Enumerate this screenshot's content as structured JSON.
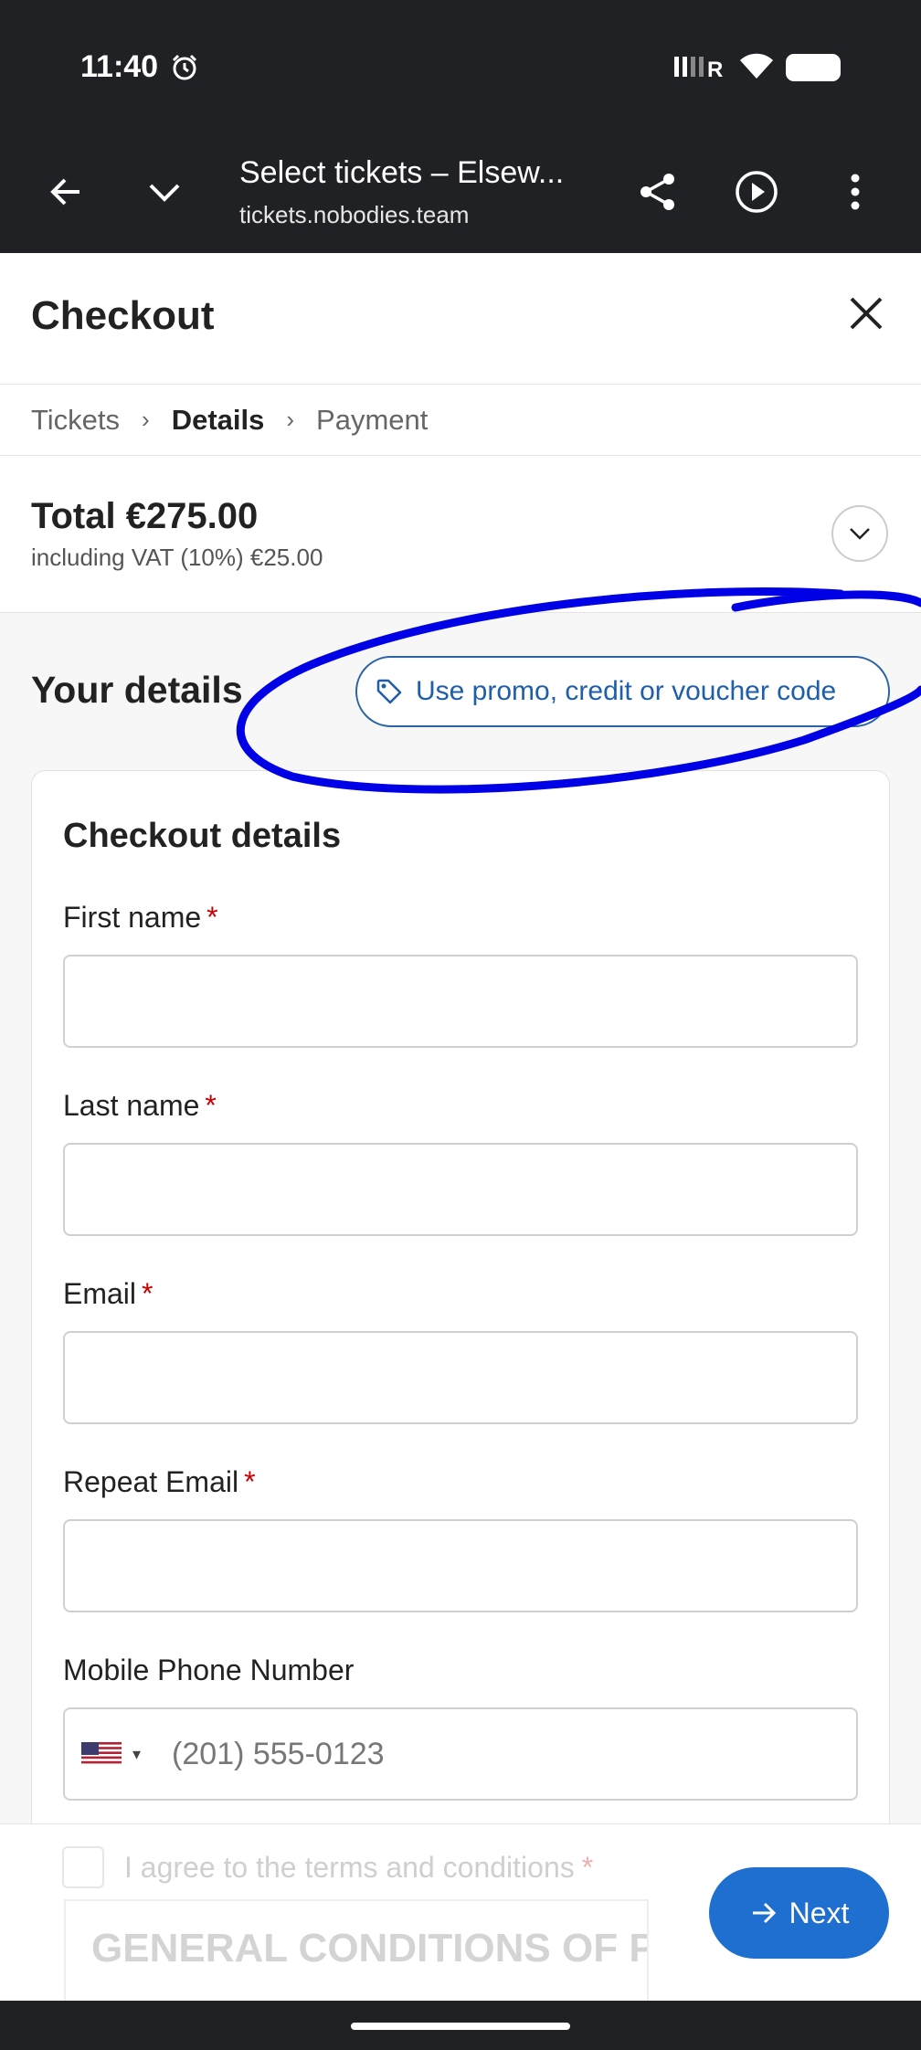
{
  "status_bar": {
    "time": "11:40",
    "icons": [
      "alarm-icon",
      "signal-icon",
      "wifi-icon",
      "battery-icon"
    ]
  },
  "browser": {
    "page_title": "Select tickets – Elsew...",
    "url": "tickets.nobodies.team",
    "icons": [
      "back-arrow-icon",
      "chevron-down-icon",
      "share-icon",
      "play-icon",
      "more-vert-icon"
    ]
  },
  "checkout": {
    "title": "Checkout",
    "breadcrumb": [
      "Tickets",
      "Details",
      "Payment"
    ],
    "active_step": "Details"
  },
  "total": {
    "label": "Total €275.00",
    "vat": "including VAT (10%) €25.00"
  },
  "details": {
    "heading": "Your details",
    "promo_label": "Use promo, credit or voucher code"
  },
  "form": {
    "heading": "Checkout details",
    "required_marker": "*",
    "fields": [
      {
        "label": "First name",
        "value": ""
      },
      {
        "label": "Last name",
        "value": ""
      },
      {
        "label": "Email",
        "value": ""
      },
      {
        "label": "Repeat Email",
        "value": ""
      }
    ],
    "phone": {
      "label": "Mobile Phone Number",
      "placeholder": "(201) 555-0123",
      "country": "US"
    }
  },
  "footer": {
    "agree_label": "I agree to the terms and conditions",
    "terms_text": "GENERAL CONDITIONS OF PARTICIPATION AND ACCESS TO",
    "next_label": "Next"
  },
  "colors": {
    "accent": "#1f6fd0",
    "promo_blue": "#1f5ea8",
    "annotation": "#0000e6",
    "dark_bar": "#202124"
  }
}
